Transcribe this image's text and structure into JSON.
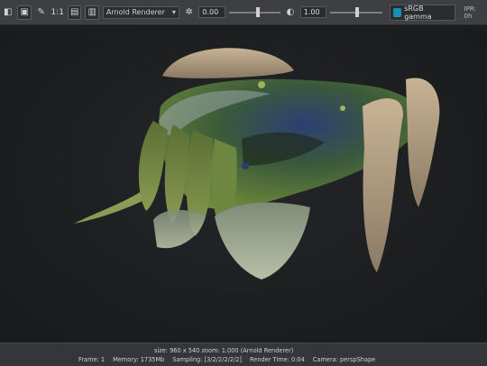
{
  "toolbar": {
    "ratio_label": "1:1",
    "renderer_select": "Arnold Renderer",
    "exposure_value": "0.00",
    "gamma_value": "1.00",
    "color_space": "sRGB gamma",
    "ipr_label": "IPR: 0h",
    "icons": [
      "render-icon",
      "snapshot-icon",
      "keep-image-icon",
      "ratio-icon",
      "save-icon",
      "region-icon",
      "settings-icon",
      "exposure-icon",
      "gamma-icon",
      "color-management-icon"
    ]
  },
  "viewport": {
    "content": "rendered-creature-image"
  },
  "status": {
    "line1": "size: 960 x 540  zoom: 1.000     (Arnold Renderer)",
    "frame": "Frame: 1",
    "memory": "Memory: 1735Mb",
    "sampling": "Sampling: [3/2/2/2/2/2]",
    "render_time": "Render Time: 0:04",
    "camera": "Camera: perspShape"
  }
}
